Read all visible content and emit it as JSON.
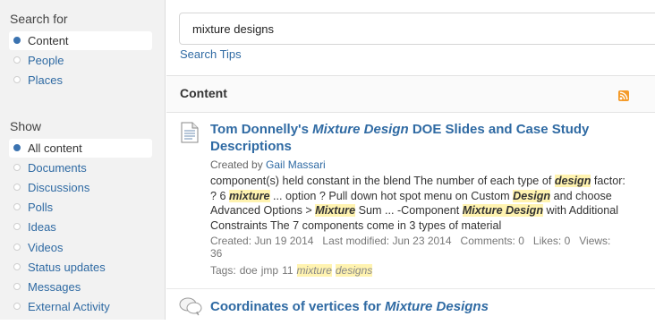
{
  "sidebar": {
    "search_for_heading": "Search for",
    "search_for_items": [
      {
        "label": "Content",
        "selected": true
      },
      {
        "label": "People",
        "selected": false
      },
      {
        "label": "Places",
        "selected": false
      }
    ],
    "show_heading": "Show",
    "show_items": [
      {
        "label": "All content",
        "selected": true
      },
      {
        "label": "Documents",
        "selected": false
      },
      {
        "label": "Discussions",
        "selected": false
      },
      {
        "label": "Polls",
        "selected": false
      },
      {
        "label": "Ideas",
        "selected": false
      },
      {
        "label": "Videos",
        "selected": false
      },
      {
        "label": "Status updates",
        "selected": false
      },
      {
        "label": "Messages",
        "selected": false
      },
      {
        "label": "External Activity",
        "selected": false
      }
    ]
  },
  "search": {
    "query": "mixture designs",
    "tips_label": "Search Tips"
  },
  "results": {
    "heading": "Content",
    "icons": {
      "feed": "rss-icon",
      "document": "document-icon",
      "discussion": "discussion-icon"
    },
    "items": [
      {
        "title_prefix": "Tom Donnelly's ",
        "title_highlight": "Mixture Design",
        "title_suffix": " DOE Slides and Case Study Descriptions",
        "created_by_label": "Created by ",
        "author": "Gail Massari",
        "snippet": [
          {
            "t": "component(s) held constant in the blend The number of each type of "
          },
          {
            "t": "design",
            "hl": true
          },
          {
            "t": " factor: ? 6 "
          },
          {
            "t": "mixture",
            "hl": true
          },
          {
            "t": " ... option ? Pull down hot spot menu on Custom "
          },
          {
            "t": "Design",
            "hl": true
          },
          {
            "t": " and choose Advanced Options > "
          },
          {
            "t": "Mixture",
            "hl": true
          },
          {
            "t": " Sum ... -Component "
          },
          {
            "t": "Mixture Design",
            "hl": true
          },
          {
            "t": " with Additional Constraints The 7 components come in 3 types of material"
          }
        ],
        "created": "Created: Jun 19 2014",
        "modified": "Last modified: Jun 23 2014",
        "comments": "Comments: 0",
        "likes": "Likes: 0",
        "views": "Views: 36",
        "tags_label": "Tags:",
        "tags": [
          {
            "t": "doe"
          },
          {
            "t": "jmp"
          },
          {
            "t": "11"
          },
          {
            "t": "mixture",
            "hl": true
          },
          {
            "t": "designs",
            "hl": true
          }
        ]
      },
      {
        "title_prefix": "Coordinates of vertices for ",
        "title_highlight": "Mixture Designs"
      }
    ]
  }
}
